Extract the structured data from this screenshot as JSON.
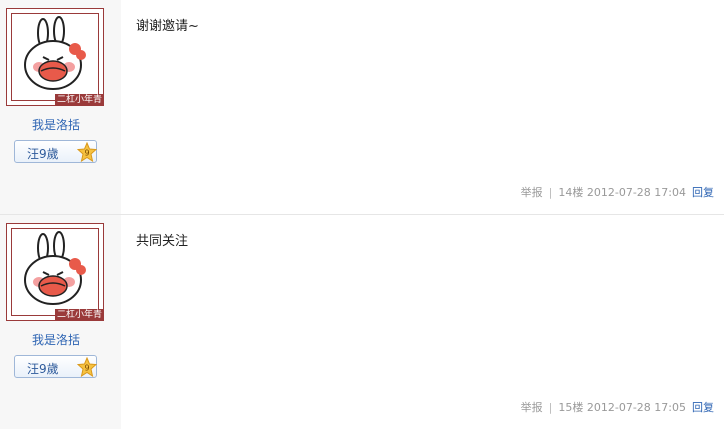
{
  "posts": [
    {
      "author": "我是洛括",
      "avatar_tag": "二杠小年青",
      "badge_label": "汪9歲",
      "badge_level": "9",
      "content": "谢谢邀请~",
      "report_label": "举报",
      "floor": "14楼",
      "timestamp": "2012-07-28 17:04",
      "reply_label": "回复"
    },
    {
      "author": "我是洛括",
      "avatar_tag": "二杠小年青",
      "badge_label": "汪9歲",
      "badge_level": "9",
      "content": "共同关注",
      "report_label": "举报",
      "floor": "15楼",
      "timestamp": "2012-07-28 17:05",
      "reply_label": "回复"
    }
  ],
  "colors": {
    "avatar_frame": "#9a3a3a",
    "link": "#2d64b3",
    "meta": "#999999"
  }
}
